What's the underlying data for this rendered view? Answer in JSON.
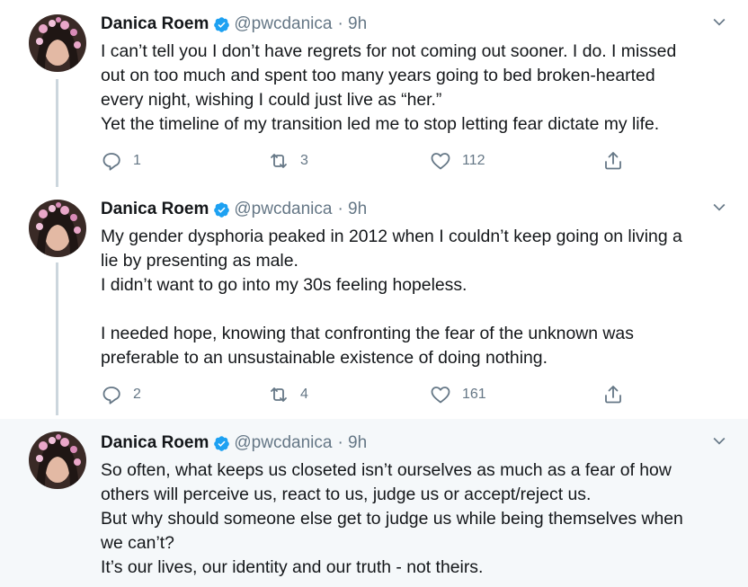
{
  "colors": {
    "text": "#14171a",
    "muted": "#657786",
    "verified": "#1da1f2",
    "thread_line": "#ccd6dd",
    "highlight_bg": "#f5f8fa"
  },
  "tweets": [
    {
      "name": "Danica Roem",
      "handle": "@pwcdanica",
      "time": "· 9h",
      "lines": [
        "I can’t tell you I don’t have regrets for not coming out sooner. I do. I missed",
        "out on too much and spent too many years going to bed broken-hearted",
        "every night, wishing I could just live as “her.”",
        "Yet the timeline of my transition led me to stop letting fear dictate my life."
      ],
      "replies": "1",
      "retweets": "3",
      "likes": "112"
    },
    {
      "name": "Danica Roem",
      "handle": "@pwcdanica",
      "time": "· 9h",
      "lines": [
        "My gender dysphoria peaked in 2012 when I couldn’t keep going on living a",
        "lie by presenting as male.",
        "I didn’t want to go into my 30s feeling hopeless.",
        "",
        "I needed hope, knowing that confronting the fear of the unknown was",
        "preferable to an unsustainable existence of doing nothing."
      ],
      "replies": "2",
      "retweets": "4",
      "likes": "161"
    },
    {
      "name": "Danica Roem",
      "handle": "@pwcdanica",
      "time": "· 9h",
      "lines": [
        "So often, what keeps us closeted isn’t ourselves as much as a fear of how",
        "others will perceive us, react to us, judge us or accept/reject us.",
        "But why should someone else get to judge us while being themselves when",
        "we can’t?",
        "It’s our lives, our identity and our truth - not theirs."
      ]
    }
  ]
}
